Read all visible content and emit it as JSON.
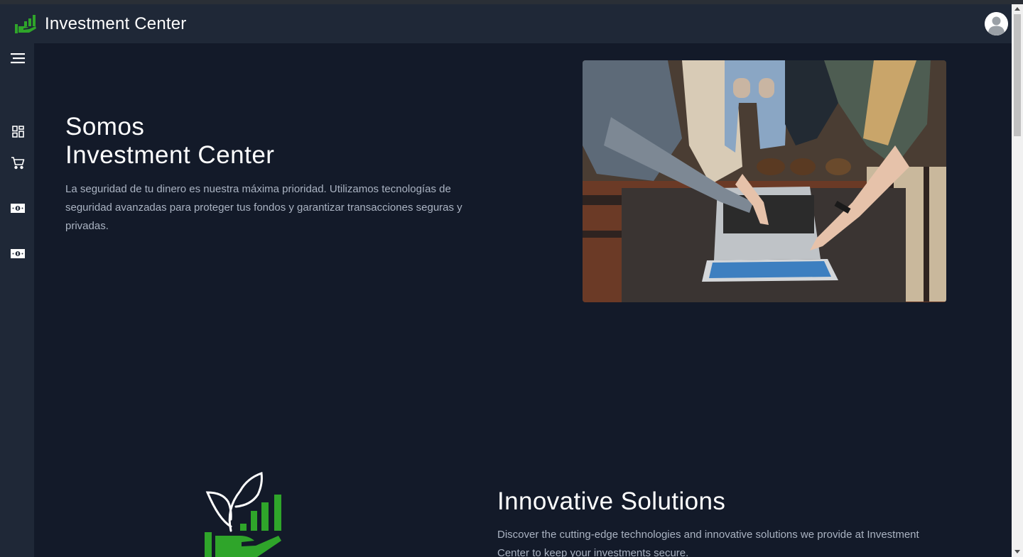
{
  "header": {
    "app_name": "Investment Center",
    "logo_icon": "investment-hand-chart-logo",
    "avatar_icon": "user-avatar-icon",
    "brand_color": "#2fa52a"
  },
  "sidebar": {
    "items": [
      {
        "name": "menu",
        "icon": "hamburger-menu-icon"
      },
      {
        "name": "dashboard",
        "icon": "dashboard-grid-icon"
      },
      {
        "name": "cart",
        "icon": "shopping-cart-icon"
      },
      {
        "name": "money-1",
        "icon": "banknote-icon"
      },
      {
        "name": "money-2",
        "icon": "banknote-icon"
      }
    ]
  },
  "hero": {
    "title_line1": "Somos",
    "title_line2": "Investment Center",
    "description": "La seguridad de tu dinero es nuestra máxima prioridad. Utilizamos tecnologías de seguridad avanzadas para proteger tus fondos y garantizar transacciones seguras y privadas.",
    "image": "people-pointing-at-laptop-photo"
  },
  "feature": {
    "title": "Innovative Solutions",
    "description": "Discover the cutting-edge technologies and innovative solutions we provide at Investment Center to keep your investments secure.",
    "icon": "plant-growth-chart-hand-icon"
  },
  "colors": {
    "background": "#131a29",
    "panel": "#1f2837",
    "accent_green": "#2fa52a",
    "muted_text": "#aab3c2"
  }
}
